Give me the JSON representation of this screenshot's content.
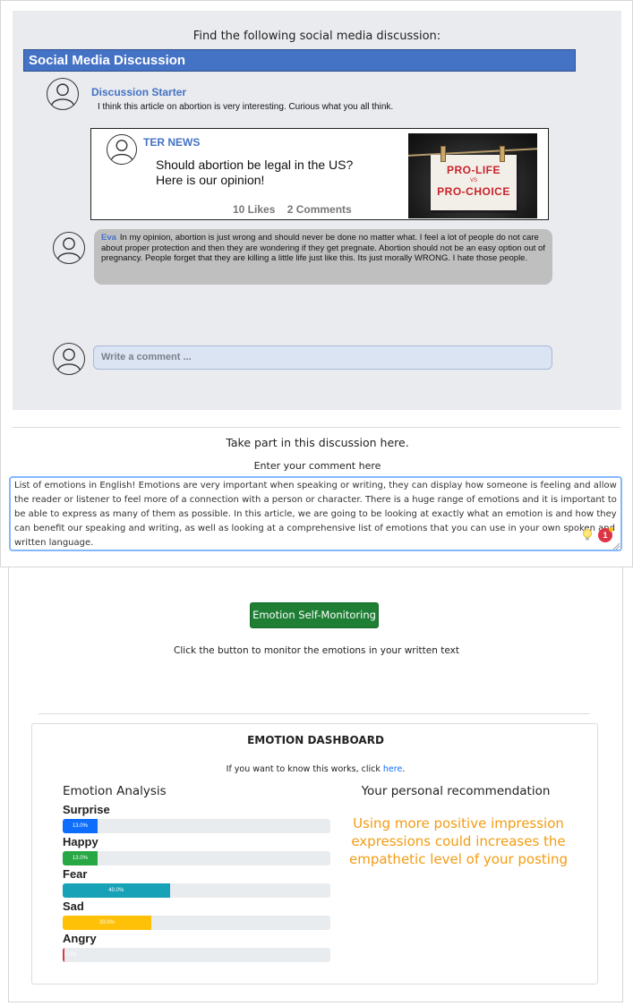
{
  "discussion": {
    "find_title": "Find the following social media discussion:",
    "header": "Social Media Discussion",
    "starter": {
      "name": "Discussion Starter",
      "text": "I think this article on abortion is very interesting. Curious what you all think."
    },
    "news": {
      "source": "TER NEWS",
      "headline_line1": "Should abortion be legal in the US?",
      "headline_line2": "Here is our opinion!",
      "stats": "10 Likes    2 Comments",
      "image_line1": "PRO-LIFE",
      "image_line2": "VS",
      "image_line3": "PRO-CHOICE"
    },
    "reply": {
      "name": "Eva",
      "text": "In my opinion, abortion is just wrong and should never be done no matter what. I feel a lot of people do not care about proper protection and then they are wondering if they get pregnate. Abortion should not be an easy option out of pregnancy. People forget that they are killing a little life just like this. Its just morally WRONG. I hate those people."
    },
    "write_comment_placeholder": "Write a comment ..."
  },
  "participation": {
    "take_part": "Take part in this discussion here.",
    "enter_comment": "Enter your comment here",
    "comment_text": "List of emotions in English! Emotions are very important when speaking or writing, they can display how someone is feeling and allow the reader or listener to feel more of a connection with a person or character. There is a huge range of emotions and it is important to be able to express as many of them as possible. In this article, we are going to be looking at exactly what an emotion is and how they can benefit our speaking and writing, as well as looking at a comprehensive list of emotions that you can use in your own spoken and written language.",
    "badge_count": "1"
  },
  "monitor": {
    "button_label": "Emotion Self-Monitoring",
    "hint": "Click the button to monitor the emotions in your written text"
  },
  "dashboard": {
    "title": "EMOTION DASHBOARD",
    "info_prefix": "If you want to know this works, click ",
    "info_link": "here",
    "info_suffix": ".",
    "analysis_title": "Emotion Analysis",
    "recommendation_title": "Your personal recommendation",
    "recommendation_text": "Using more positive impression expressions could increases the empathetic level of your posting",
    "emotions": [
      {
        "label": "Surprise",
        "percent": 13.0,
        "percent_text": "13.0%",
        "color": "#0d6efd"
      },
      {
        "label": "Happy",
        "percent": 13.0,
        "percent_text": "13.0%",
        "color": "#28a745"
      },
      {
        "label": "Fear",
        "percent": 40.0,
        "percent_text": "40.0%",
        "color": "#17a2b8"
      },
      {
        "label": "Sad",
        "percent": 33.0,
        "percent_text": "33.0%",
        "color": "#ffc107"
      },
      {
        "label": "Angry",
        "percent": 0.0,
        "percent_text": "0.0%",
        "color": "#dc3545"
      }
    ]
  }
}
